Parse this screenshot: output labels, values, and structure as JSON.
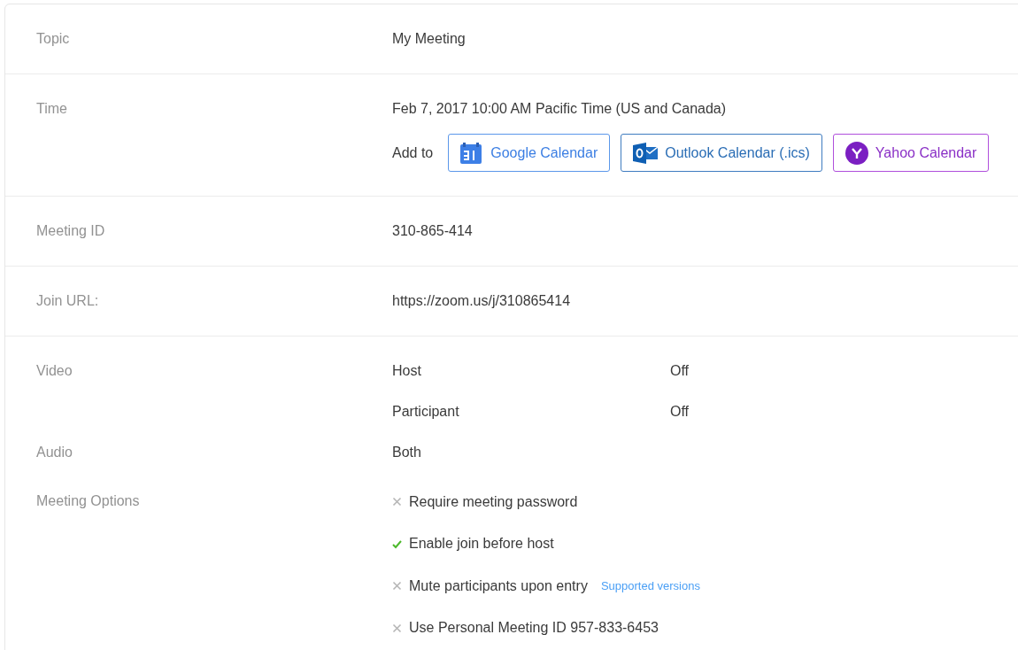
{
  "sections": [
    {
      "rows": [
        {
          "kind": "text",
          "label": "Topic",
          "value": "My Meeting"
        }
      ]
    },
    {
      "rows": [
        {
          "kind": "time",
          "label": "Time",
          "value": "Feb 7, 2017 10:00 AM Pacific Time (US and Canada)",
          "add_to": "Add to",
          "calendars": [
            {
              "kind": "google",
              "label": "Google Calendar"
            },
            {
              "kind": "outlook",
              "label": "Outlook Calendar (.ics)"
            },
            {
              "kind": "yahoo",
              "label": "Yahoo Calendar"
            }
          ]
        }
      ]
    },
    {
      "rows": [
        {
          "kind": "text",
          "label": "Meeting ID",
          "value": "310-865-414"
        }
      ]
    },
    {
      "rows": [
        {
          "kind": "text",
          "label": "Join URL:",
          "value": "https://zoom.us/j/310865414"
        }
      ]
    },
    {
      "rows": [
        {
          "kind": "pairs",
          "label": "Video",
          "pairs": [
            {
              "name": "Host",
              "value": "Off"
            },
            {
              "name": "Participant",
              "value": "Off"
            }
          ]
        },
        {
          "kind": "text",
          "label": "Audio",
          "value": "Both"
        },
        {
          "kind": "options",
          "label": "Meeting Options",
          "options": [
            {
              "text": "Require meeting password",
              "checked": false
            },
            {
              "text": "Enable join before host",
              "checked": true
            },
            {
              "text": "Mute participants upon entry",
              "checked": false,
              "link": "Supported versions"
            },
            {
              "text": "Use Personal Meeting ID 957-833-6453",
              "checked": false
            }
          ]
        }
      ]
    }
  ]
}
